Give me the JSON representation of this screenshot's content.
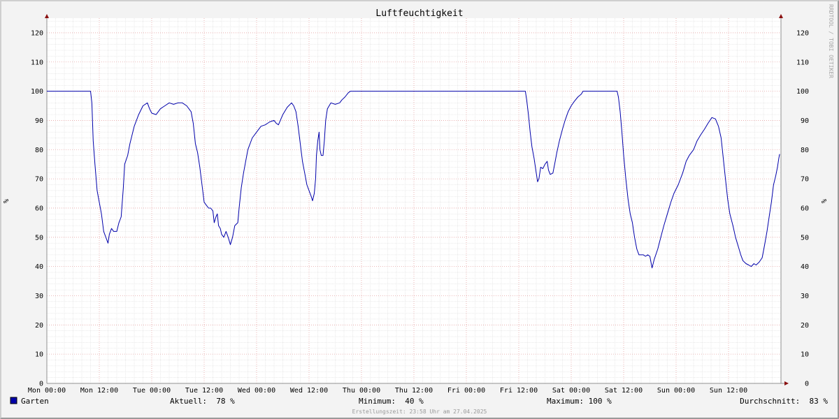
{
  "chart_data": {
    "type": "line",
    "title": "Luftfeuchtigkeit",
    "ylabel": "%",
    "ylim": [
      0,
      125
    ],
    "y_ticks": [
      0,
      10,
      20,
      30,
      40,
      50,
      60,
      70,
      80,
      90,
      100,
      110,
      120
    ],
    "xlim": [
      0,
      168
    ],
    "x_ticks": [
      {
        "hour": 0,
        "label": "Mon 00:00"
      },
      {
        "hour": 12,
        "label": "Mon 12:00"
      },
      {
        "hour": 24,
        "label": "Tue 00:00"
      },
      {
        "hour": 36,
        "label": "Tue 12:00"
      },
      {
        "hour": 48,
        "label": "Wed 00:00"
      },
      {
        "hour": 60,
        "label": "Wed 12:00"
      },
      {
        "hour": 72,
        "label": "Thu 00:00"
      },
      {
        "hour": 84,
        "label": "Thu 12:00"
      },
      {
        "hour": 96,
        "label": "Fri 00:00"
      },
      {
        "hour": 108,
        "label": "Fri 12:00"
      },
      {
        "hour": 120,
        "label": "Sat 00:00"
      },
      {
        "hour": 132,
        "label": "Sat 12:00"
      },
      {
        "hour": 144,
        "label": "Sun 00:00"
      },
      {
        "hour": 156,
        "label": "Sun 12:00"
      }
    ],
    "grid": true,
    "series": [
      {
        "name": "Garten",
        "color": "#0000aa",
        "points": [
          [
            0,
            100
          ],
          [
            10,
            100
          ],
          [
            10.3,
            96
          ],
          [
            10.6,
            83
          ],
          [
            11,
            75
          ],
          [
            11.5,
            66
          ],
          [
            12,
            62
          ],
          [
            12.5,
            58
          ],
          [
            13,
            52
          ],
          [
            13.5,
            50
          ],
          [
            14,
            48
          ],
          [
            14.3,
            51
          ],
          [
            14.8,
            53
          ],
          [
            15.3,
            52
          ],
          [
            16,
            52
          ],
          [
            16.5,
            55
          ],
          [
            17,
            57
          ],
          [
            17.5,
            67
          ],
          [
            17.8,
            75
          ],
          [
            18.5,
            78
          ],
          [
            19,
            82
          ],
          [
            20,
            88
          ],
          [
            21,
            92
          ],
          [
            22,
            95
          ],
          [
            23,
            96
          ],
          [
            23.5,
            94
          ],
          [
            24,
            92.5
          ],
          [
            25,
            92
          ],
          [
            26,
            94
          ],
          [
            27,
            95
          ],
          [
            28,
            96
          ],
          [
            29,
            95.5
          ],
          [
            30,
            96
          ],
          [
            31,
            96
          ],
          [
            32,
            95
          ],
          [
            33,
            93
          ],
          [
            33.5,
            89
          ],
          [
            34,
            82
          ],
          [
            34.5,
            79
          ],
          [
            35,
            74
          ],
          [
            35.5,
            68
          ],
          [
            36,
            62
          ],
          [
            36.5,
            61
          ],
          [
            37,
            60
          ],
          [
            37.5,
            60
          ],
          [
            38,
            59
          ],
          [
            38.3,
            55
          ],
          [
            38.7,
            57
          ],
          [
            39,
            58
          ],
          [
            39.3,
            54
          ],
          [
            39.7,
            53
          ],
          [
            40,
            51
          ],
          [
            40.5,
            50
          ],
          [
            41,
            52
          ],
          [
            41.5,
            50
          ],
          [
            42,
            47.5
          ],
          [
            42.5,
            50
          ],
          [
            43,
            54
          ],
          [
            43.7,
            55
          ],
          [
            44,
            60
          ],
          [
            44.5,
            67
          ],
          [
            45,
            72
          ],
          [
            45.5,
            76
          ],
          [
            46,
            80
          ],
          [
            47,
            84
          ],
          [
            48,
            86
          ],
          [
            49,
            88
          ],
          [
            50,
            88.5
          ],
          [
            51,
            89.5
          ],
          [
            52,
            90
          ],
          [
            52.5,
            89
          ],
          [
            53,
            88.5
          ],
          [
            54,
            92
          ],
          [
            55,
            94.5
          ],
          [
            56,
            96
          ],
          [
            56.5,
            95
          ],
          [
            57,
            93
          ],
          [
            57.5,
            88
          ],
          [
            58,
            82
          ],
          [
            58.5,
            76
          ],
          [
            59,
            72
          ],
          [
            59.5,
            68
          ],
          [
            60,
            66
          ],
          [
            60.5,
            64
          ],
          [
            60.8,
            62.5
          ],
          [
            61.2,
            65
          ],
          [
            61.5,
            70
          ],
          [
            61.7,
            78
          ],
          [
            62,
            83
          ],
          [
            62.3,
            86
          ],
          [
            62.5,
            80
          ],
          [
            62.8,
            78
          ],
          [
            63.2,
            78
          ],
          [
            63.5,
            83
          ],
          [
            63.8,
            90
          ],
          [
            64.2,
            94
          ],
          [
            65,
            96
          ],
          [
            66,
            95.5
          ],
          [
            67,
            96
          ],
          [
            67.5,
            97
          ],
          [
            68.2,
            98
          ],
          [
            69,
            99.5
          ],
          [
            69.5,
            100
          ],
          [
            109.5,
            100
          ],
          [
            109.8,
            97
          ],
          [
            110.2,
            92
          ],
          [
            110.6,
            86
          ],
          [
            111,
            81
          ],
          [
            111.5,
            77
          ],
          [
            112,
            72
          ],
          [
            112.3,
            69
          ],
          [
            112.6,
            70
          ],
          [
            113,
            74
          ],
          [
            113.5,
            73.5
          ],
          [
            114,
            75
          ],
          [
            114.5,
            76
          ],
          [
            114.8,
            73
          ],
          [
            115.2,
            71.5
          ],
          [
            115.8,
            72
          ],
          [
            116.2,
            75
          ],
          [
            116.7,
            79
          ],
          [
            117.3,
            83
          ],
          [
            118,
            87
          ],
          [
            118.6,
            90
          ],
          [
            119.3,
            93
          ],
          [
            120,
            95
          ],
          [
            120.7,
            96.5
          ],
          [
            121.5,
            98
          ],
          [
            122.3,
            99
          ],
          [
            122.7,
            100
          ],
          [
            130.5,
            100
          ],
          [
            130.8,
            98
          ],
          [
            131.2,
            93
          ],
          [
            131.6,
            86
          ],
          [
            132,
            78
          ],
          [
            132.5,
            70
          ],
          [
            133,
            63
          ],
          [
            133.5,
            58
          ],
          [
            134,
            55
          ],
          [
            134.5,
            50
          ],
          [
            135,
            46
          ],
          [
            135.5,
            44
          ],
          [
            136.5,
            44
          ],
          [
            137,
            43.5
          ],
          [
            137.5,
            44
          ],
          [
            138,
            43.5
          ],
          [
            138.5,
            39.5
          ],
          [
            139,
            42.5
          ],
          [
            139.8,
            46
          ],
          [
            140.5,
            50
          ],
          [
            141.2,
            54
          ],
          [
            142,
            58
          ],
          [
            142.8,
            62
          ],
          [
            143.5,
            65
          ],
          [
            144.5,
            68
          ],
          [
            145.5,
            72
          ],
          [
            146.3,
            76
          ],
          [
            147,
            78
          ],
          [
            148,
            80
          ],
          [
            148.8,
            83
          ],
          [
            149.6,
            85
          ],
          [
            150.5,
            87
          ],
          [
            151.3,
            89
          ],
          [
            152.2,
            91
          ],
          [
            153,
            90.5
          ],
          [
            153.7,
            88
          ],
          [
            154.3,
            84
          ],
          [
            154.8,
            77
          ],
          [
            155.3,
            70
          ],
          [
            155.8,
            63
          ],
          [
            156.3,
            58
          ],
          [
            157,
            54
          ],
          [
            157.6,
            50
          ],
          [
            158.2,
            47
          ],
          [
            158.8,
            44
          ],
          [
            159.3,
            42
          ],
          [
            160,
            41
          ],
          [
            160.6,
            40.5
          ],
          [
            161.2,
            40
          ],
          [
            161.8,
            41
          ],
          [
            162.3,
            40.5
          ],
          [
            163,
            41.5
          ],
          [
            163.7,
            43
          ],
          [
            164.2,
            47
          ],
          [
            164.8,
            52
          ],
          [
            165.3,
            57
          ],
          [
            165.8,
            62
          ],
          [
            166.3,
            68
          ],
          [
            166.8,
            71
          ],
          [
            167.2,
            74
          ],
          [
            167.5,
            77
          ],
          [
            167.7,
            78.5
          ]
        ]
      }
    ],
    "legend": {
      "series_name": "Garten",
      "color": "#0000aa",
      "aktuell": "Aktuell:  78 %",
      "minimum": "Minimum:  40 %",
      "maximum": "Maximum: 100 %",
      "durchschnitt": "Durchschnitt:  83 %"
    }
  },
  "footer": "Erstellungszeit: 23:58 Uhr am 27.04.2025",
  "watermark": "RRDTOOL / TOBI OETIKER",
  "colors": {
    "background": "#f3f3f3",
    "canvas": "#ffffff",
    "minor_grid": "#d6d6d6",
    "major_grid": "#e6a3a3",
    "axis": "#909090",
    "arrow": "#8a1010"
  }
}
